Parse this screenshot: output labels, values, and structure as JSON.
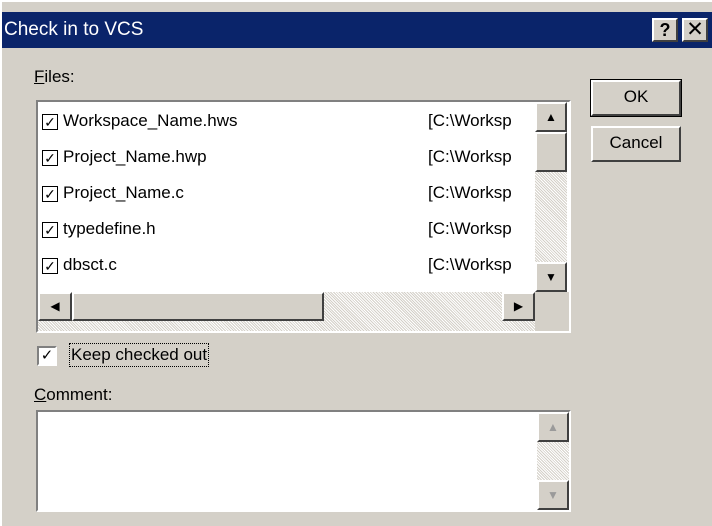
{
  "window": {
    "title": "Check in to VCS",
    "help_label": "?",
    "close_label": "✕"
  },
  "files": {
    "label": "Files:",
    "label_rest": "iles:",
    "label_access": "F",
    "items": [
      {
        "name": "Workspace_Name.hws",
        "path": "[C:\\Worksp",
        "checked": true
      },
      {
        "name": "Project_Name.hwp",
        "path": "[C:\\Worksp",
        "checked": true
      },
      {
        "name": "Project_Name.c",
        "path": "[C:\\Worksp",
        "checked": true
      },
      {
        "name": "typedefine.h",
        "path": "[C:\\Worksp",
        "checked": true
      },
      {
        "name": "dbsct.c",
        "path": "[C:\\Worksp",
        "checked": true
      }
    ],
    "check_glyph": "✓"
  },
  "buttons": {
    "ok": "OK",
    "cancel": "Cancel"
  },
  "keep_checked_out": {
    "label": "Keep checked out",
    "checked": true,
    "glyph": "✓"
  },
  "comment": {
    "label": "Comment:",
    "label_access": "C",
    "label_rest": "omment:",
    "value": ""
  },
  "icons": {
    "up": "▲",
    "down": "▼",
    "left": "◀",
    "right": "▶"
  },
  "colors": {
    "titlebar": "#0a246a",
    "face": "#d4d0c8"
  }
}
